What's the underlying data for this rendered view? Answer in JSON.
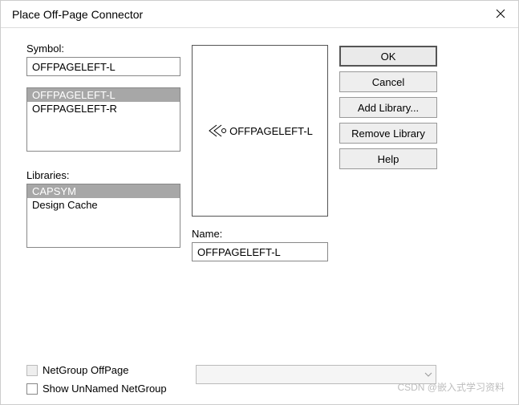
{
  "title": "Place Off-Page Connector",
  "symbol": {
    "label": "Symbol:",
    "value": "OFFPAGELEFT-L",
    "list": [
      {
        "text": "OFFPAGELEFT-L",
        "selected": true
      },
      {
        "text": "OFFPAGELEFT-R",
        "selected": false
      }
    ]
  },
  "libraries": {
    "label": "Libraries:",
    "list": [
      {
        "text": "CAPSYM",
        "selected": true
      },
      {
        "text": "Design Cache",
        "selected": false
      }
    ]
  },
  "preview": {
    "symbol_name": "OFFPAGELEFT-L"
  },
  "name": {
    "label": "Name:",
    "value": "OFFPAGELEFT-L"
  },
  "buttons": {
    "ok": "OK",
    "cancel": "Cancel",
    "add_library": "Add Library...",
    "remove_library": "Remove Library",
    "help": "Help"
  },
  "footer": {
    "netgroup_offpage": "NetGroup OffPage",
    "show_unnamed": "Show UnNamed NetGroup",
    "combo_value": ""
  },
  "watermark": "CSDN @嵌入式学习资料"
}
